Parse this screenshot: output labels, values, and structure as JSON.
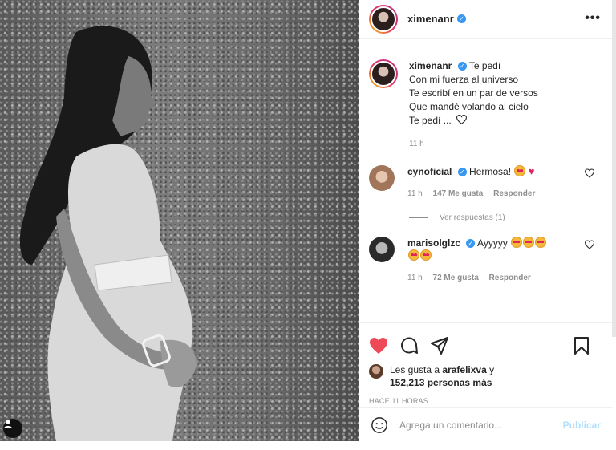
{
  "header": {
    "username": "ximenanr",
    "more": "•••"
  },
  "caption": {
    "username": "ximenanr",
    "lines": [
      "Te pedí",
      "Con mi fuerza al universo",
      "Te escribí en un par de versos",
      "Que mandé volando al cielo",
      "Te pedí ..."
    ],
    "time": "11 h"
  },
  "comments": [
    {
      "username": "cynoficial",
      "text": "Hermosa!",
      "time": "11 h",
      "likes": "147 Me gusta",
      "reply": "Responder",
      "view_replies": "Ver respuestas (1)"
    },
    {
      "username": "marisolglzc",
      "text": "Ayyyyy",
      "time": "11 h",
      "likes": "72 Me gusta",
      "reply": "Responder"
    }
  ],
  "likes": {
    "prefix": "Les gusta a",
    "user": "arafelixva",
    "suffix": "y",
    "count": "152,213 personas más"
  },
  "post_age": "HACE 11 HORAS",
  "comment_box": {
    "placeholder": "Agrega un comentario...",
    "publish": "Publicar"
  },
  "colors": {
    "accent": "#3897f0",
    "like": "#ed4956",
    "publish_disabled": "#b2dffc"
  }
}
